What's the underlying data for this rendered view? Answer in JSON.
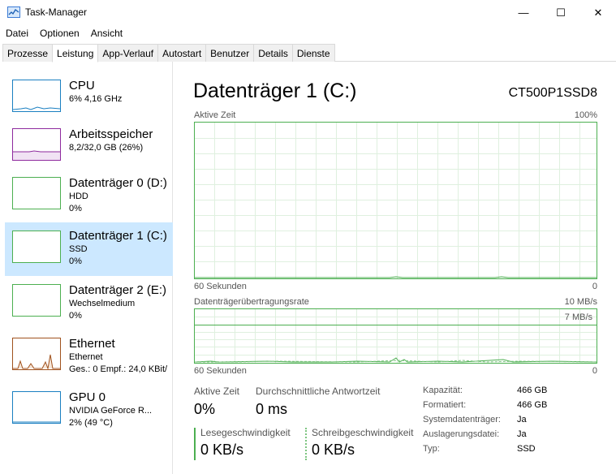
{
  "window": {
    "title": "Task-Manager",
    "minimize_glyph": "—",
    "maximize_glyph": "☐",
    "close_glyph": "✕",
    "app_icon": "task-manager-icon"
  },
  "menu": [
    "Datei",
    "Optionen",
    "Ansicht"
  ],
  "tabs": [
    "Prozesse",
    "Leistung",
    "App-Verlauf",
    "Autostart",
    "Benutzer",
    "Details",
    "Dienste"
  ],
  "active_tab": "Leistung",
  "resources": [
    {
      "title": "CPU",
      "sub1": "6%  4,16 GHz",
      "sub2": "",
      "color": "#1a7fc1"
    },
    {
      "title": "Arbeitsspeicher",
      "sub1": "8,2/32,0 GB (26%)",
      "sub2": "",
      "color": "#8e2a9e"
    },
    {
      "title": "Datenträger 0 (D:)",
      "sub1": "HDD",
      "sub2": "0%",
      "color": "#4caf50"
    },
    {
      "title": "Datenträger 1 (C:)",
      "sub1": "SSD",
      "sub2": "0%",
      "color": "#4caf50"
    },
    {
      "title": "Datenträger 2 (E:)",
      "sub1": "Wechselmedium",
      "sub2": "0%",
      "color": "#4caf50"
    },
    {
      "title": "Ethernet",
      "sub1": "Ethernet",
      "sub2": "Ges.: 0 Empf.: 24,0 KBit/",
      "color": "#a0521e"
    },
    {
      "title": "GPU 0",
      "sub1": "NVIDIA GeForce R...",
      "sub2": "2%  (49 °C)",
      "color": "#1a7fc1"
    }
  ],
  "selected_resource_index": 3,
  "detail": {
    "title": "Datenträger 1 (C:)",
    "model": "CT500P1SSD8",
    "graph1": {
      "label": "Aktive Zeit",
      "max": "100%",
      "time": "60 Sekunden",
      "min": "0"
    },
    "graph2": {
      "label": "Datenträgerübertragungsrate",
      "max": "10 MB/s",
      "inner": "7 MB/s",
      "time": "60 Sekunden",
      "min": "0"
    },
    "stats": {
      "active_label": "Aktive Zeit",
      "active_value": "0%",
      "response_label": "Durchschnittliche Antwortzeit",
      "response_value": "0 ms",
      "read_label": "Lesegeschwindigkeit",
      "read_value": "0 KB/s",
      "write_label": "Schreibgeschwindigkeit",
      "write_value": "0 KB/s"
    },
    "properties": [
      {
        "key": "Kapazität:",
        "value": "466 GB"
      },
      {
        "key": "Formatiert:",
        "value": "466 GB"
      },
      {
        "key": "Systemdatenträger:",
        "value": "Ja"
      },
      {
        "key": "Auslagerungsdatei:",
        "value": "Ja"
      },
      {
        "key": "Typ:",
        "value": "SSD"
      }
    ]
  },
  "colors": {
    "disk": "#4caf50",
    "selected_bg": "#cce8ff"
  }
}
